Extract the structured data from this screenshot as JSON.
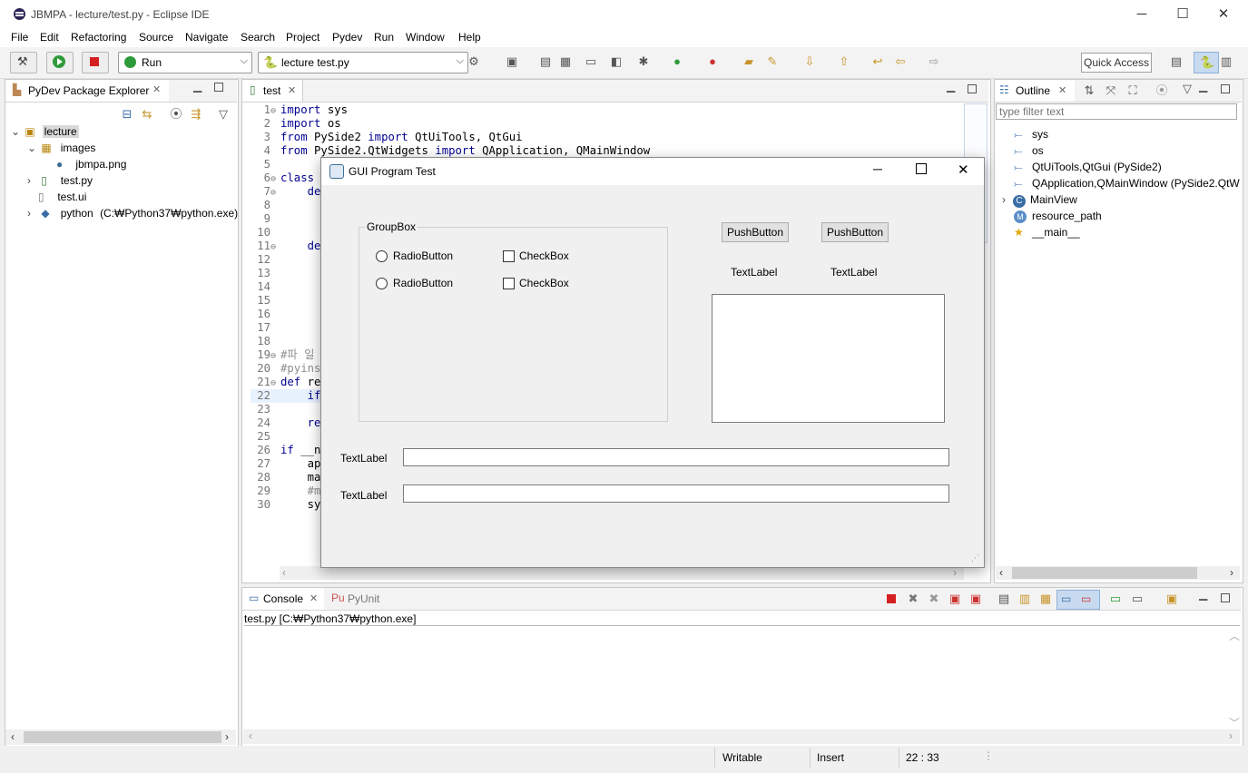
{
  "window": {
    "title": "JBMPA - lecture/test.py - Eclipse IDE",
    "minimize": "─",
    "maximize": "☐",
    "close": "✕"
  },
  "menu": [
    "File",
    "Edit",
    "Refactoring",
    "Source",
    "Navigate",
    "Search",
    "Project",
    "Pydev",
    "Run",
    "Window",
    "Help"
  ],
  "toolbar": {
    "run_config": "Run",
    "launch_target": "lecture test.py",
    "quick_access": "Quick Access"
  },
  "explorer": {
    "title": "PyDev Package Explorer",
    "tree": [
      {
        "label": "lecture",
        "icon": "project-icon"
      },
      {
        "label": "images",
        "icon": "package-icon"
      },
      {
        "label": "jbmpa.png",
        "icon": "image-file-icon"
      },
      {
        "label": "test.py",
        "icon": "python-file-icon"
      },
      {
        "label": "test.ui",
        "icon": "file-icon"
      },
      {
        "label": "python",
        "detail": "(C:₩Python37₩python.exe)",
        "icon": "python-interpreter-icon"
      }
    ]
  },
  "editor": {
    "tab": "test",
    "lines": [
      {
        "n": "1",
        "fold": true,
        "code": [
          [
            "kw",
            "import"
          ],
          [
            "",
            "sys"
          ]
        ]
      },
      {
        "n": "2",
        "code": [
          [
            "kw",
            "import"
          ],
          [
            "",
            "os"
          ]
        ]
      },
      {
        "n": "3",
        "code": [
          [
            "kw",
            "from"
          ],
          [
            "",
            " PySide2 "
          ],
          [
            "kw",
            "import"
          ],
          [
            "",
            " QtUiTools, QtGui"
          ]
        ]
      },
      {
        "n": "4",
        "code": [
          [
            "kw",
            "from"
          ],
          [
            "",
            " PySide2.QtWidgets "
          ],
          [
            "kw",
            "import"
          ],
          [
            "",
            " QApplication, QMainWindow"
          ]
        ]
      },
      {
        "n": "5",
        "code": []
      },
      {
        "n": "6",
        "fold": true,
        "code": [
          [
            "kw",
            "class"
          ]
        ]
      },
      {
        "n": "7",
        "fold": true,
        "code": [
          [
            "",
            "    "
          ],
          [
            "kw",
            "de"
          ]
        ]
      },
      {
        "n": "8",
        "code": []
      },
      {
        "n": "9",
        "code": []
      },
      {
        "n": "10",
        "code": []
      },
      {
        "n": "11",
        "fold": true,
        "code": [
          [
            "",
            "    "
          ],
          [
            "kw",
            "de"
          ]
        ]
      },
      {
        "n": "12",
        "code": []
      },
      {
        "n": "13",
        "code": []
      },
      {
        "n": "14",
        "code": []
      },
      {
        "n": "15",
        "code": []
      },
      {
        "n": "16",
        "code": []
      },
      {
        "n": "17",
        "code": []
      },
      {
        "n": "18",
        "code": []
      },
      {
        "n": "19",
        "fold": true,
        "code": [
          [
            "cm",
            "#파 일"
          ]
        ]
      },
      {
        "n": "20",
        "code": [
          [
            "cm",
            "#pyins"
          ]
        ]
      },
      {
        "n": "21",
        "fold": true,
        "code": [
          [
            "kw",
            "def"
          ],
          [
            "",
            " re"
          ]
        ]
      },
      {
        "n": "22",
        "code": [
          [
            "",
            "    "
          ],
          [
            "kw",
            "if"
          ]
        ]
      },
      {
        "n": "23",
        "code": []
      },
      {
        "n": "24",
        "code": [
          [
            "",
            "    "
          ],
          [
            "kw",
            "re"
          ]
        ]
      },
      {
        "n": "25",
        "code": []
      },
      {
        "n": "26",
        "code": [
          [
            "kw",
            "if"
          ],
          [
            "",
            " __n"
          ]
        ]
      },
      {
        "n": "27",
        "code": [
          [
            "",
            "    ap"
          ]
        ]
      },
      {
        "n": "28",
        "code": [
          [
            "",
            "    ma"
          ]
        ]
      },
      {
        "n": "29",
        "code": [
          [
            "",
            "    "
          ],
          [
            "cm",
            "#m"
          ]
        ]
      },
      {
        "n": "30",
        "code": [
          [
            "",
            "    sy"
          ]
        ]
      }
    ]
  },
  "outline": {
    "title": "Outline",
    "filter_placeholder": "type filter text",
    "items": [
      {
        "label": "sys",
        "icon": "import-icon"
      },
      {
        "label": "os",
        "icon": "import-icon"
      },
      {
        "label": "QtUiTools,QtGui (PySide2)",
        "icon": "import-icon"
      },
      {
        "label": "QApplication,QMainWindow (PySide2.QtW",
        "icon": "import-icon"
      },
      {
        "label": "MainView",
        "icon": "class-icon"
      },
      {
        "label": "resource_path",
        "icon": "method-icon"
      },
      {
        "label": "__main__",
        "icon": "main-icon"
      }
    ]
  },
  "console": {
    "tabs": [
      "Console",
      "PyUnit"
    ],
    "header": "test.py [C:₩Python37₩python.exe]"
  },
  "status": {
    "writable": "Writable",
    "mode": "Insert",
    "position": "22 : 33"
  },
  "dialog": {
    "title": "GUI Program Test",
    "groupbox_title": "GroupBox",
    "radio1": "RadioButton",
    "radio2": "RadioButton",
    "check1": "CheckBox",
    "check2": "CheckBox",
    "push1": "PushButton",
    "push2": "PushButton",
    "label_top1": "TextLabel",
    "label_top2": "TextLabel",
    "label_row1": "TextLabel",
    "label_row2": "TextLabel"
  }
}
